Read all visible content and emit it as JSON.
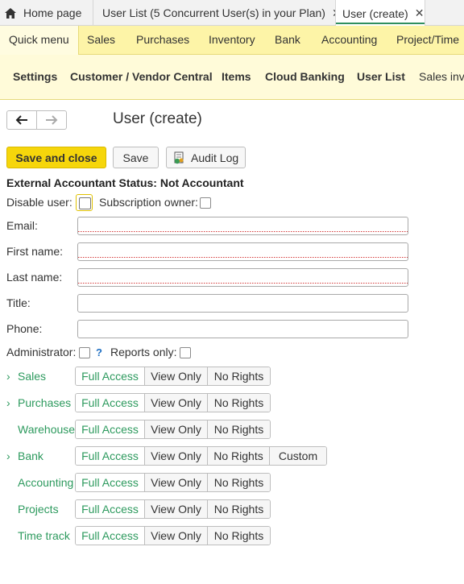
{
  "tabs": [
    {
      "label": "Home page"
    },
    {
      "label": "User List (5 Concurrent User(s) in your Plan)"
    },
    {
      "label": "User (create)"
    }
  ],
  "menu": {
    "quick": "Quick menu",
    "items": [
      "Sales",
      "Purchases",
      "Inventory",
      "Bank",
      "Accounting",
      "Project/Time"
    ]
  },
  "submenu": [
    "Settings",
    "Customer / Vendor Central",
    "Items",
    "Cloud Banking",
    "User List",
    "Sales inve"
  ],
  "page": {
    "title": "User (create)"
  },
  "toolbar": {
    "save_close": "Save and close",
    "save": "Save",
    "audit_log": "Audit Log"
  },
  "status": {
    "external_accountant": "External Accountant Status: Not Accountant"
  },
  "checks": {
    "disable_user": "Disable user:",
    "subscription_owner": "Subscription owner:",
    "administrator": "Administrator:",
    "help": "?",
    "reports_only": "Reports only:"
  },
  "fields": [
    {
      "label": "Email:",
      "value": "",
      "required": true
    },
    {
      "label": "First name:",
      "value": "",
      "required": true
    },
    {
      "label": "Last name:",
      "value": "",
      "required": true
    },
    {
      "label": "Title:",
      "value": "",
      "required": false
    },
    {
      "label": "Phone:",
      "value": "",
      "required": false
    }
  ],
  "rights": {
    "options": {
      "full": "Full Access",
      "view": "View Only",
      "none": "No Rights",
      "custom": "Custom"
    },
    "modules": [
      {
        "name": "Sales",
        "expandable": true
      },
      {
        "name": "Purchases",
        "expandable": true
      },
      {
        "name": "Warehouse",
        "expandable": false
      },
      {
        "name": "Bank",
        "expandable": true
      },
      {
        "name": "Accounting",
        "expandable": false
      },
      {
        "name": "Projects",
        "expandable": false
      },
      {
        "name": "Time track",
        "expandable": false
      }
    ]
  },
  "icons": {
    "home": "home-icon",
    "close": "close-icon",
    "back": "arrow-left-icon",
    "forward": "arrow-right-icon",
    "audit": "audit-log-icon",
    "chevron": "chevron-right-icon"
  },
  "colors": {
    "accent_yellow": "#f6d60b",
    "menu_bg": "#fdf4a7",
    "submenu_bg": "#fffbd9",
    "green": "#2d9a5e",
    "help_blue": "#1f6fc2"
  }
}
